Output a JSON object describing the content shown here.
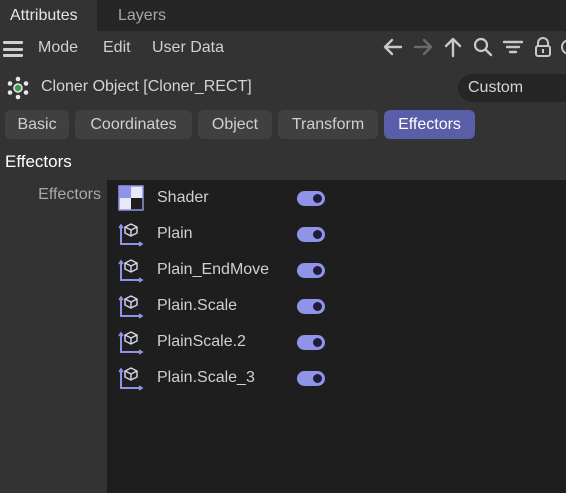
{
  "tabs": [
    {
      "label": "Attributes",
      "active": true
    },
    {
      "label": "Layers",
      "active": false
    }
  ],
  "menu": {
    "mode": "Mode",
    "edit": "Edit",
    "user_data": "User Data"
  },
  "toolbar_icons": [
    "arrow-left-icon",
    "arrow-right-icon",
    "arrow-up-icon",
    "search-icon",
    "filter-icon",
    "lock-icon",
    "circle-icon"
  ],
  "object": {
    "title": "Cloner Object [Cloner_RECT]",
    "mode_dropdown": "Custom"
  },
  "property_tabs": [
    {
      "label": "Basic",
      "active": false
    },
    {
      "label": "Coordinates",
      "active": false
    },
    {
      "label": "Object",
      "active": false
    },
    {
      "label": "Transform",
      "active": false
    },
    {
      "label": "Effectors",
      "active": true
    }
  ],
  "section": {
    "title": "Effectors",
    "field_label": "Effectors"
  },
  "effectors": [
    {
      "name": "Shader",
      "icon": "shader-effector-icon",
      "enabled": true
    },
    {
      "name": "Plain",
      "icon": "plain-effector-icon",
      "enabled": true
    },
    {
      "name": "Plain_EndMove",
      "icon": "plain-effector-icon",
      "enabled": true
    },
    {
      "name": "Plain.Scale",
      "icon": "plain-effector-icon",
      "enabled": true
    },
    {
      "name": "PlainScale.2",
      "icon": "plain-effector-icon",
      "enabled": true
    },
    {
      "name": "Plain.Scale_3",
      "icon": "plain-effector-icon",
      "enabled": true
    }
  ],
  "colors": {
    "accent": "#5a5ea8",
    "toggle": "#8f94e8",
    "panel": "#333333",
    "list_bg": "#1e1e1e"
  }
}
